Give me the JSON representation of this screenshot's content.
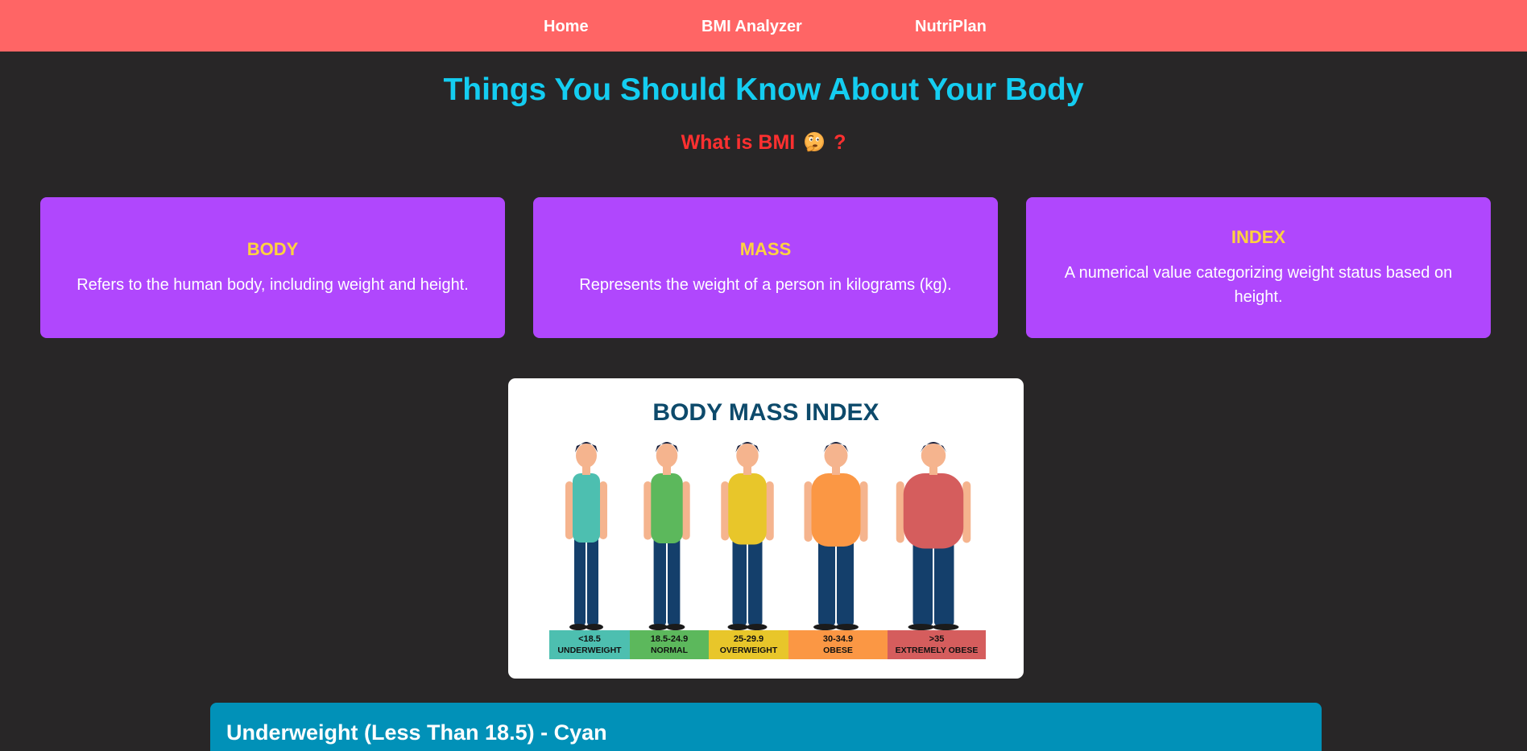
{
  "nav": {
    "home": "Home",
    "bmi_analyzer": "BMI Analyzer",
    "nutriplan": "NutriPlan"
  },
  "hero": {
    "title": "Things You Should Know About Your Body",
    "subtitle_prefix": "What is BMI",
    "subtitle_suffix": "?",
    "emoji": "thinking-face-icon"
  },
  "cards": [
    {
      "title": "BODY",
      "text": "Refers to the human body, including weight and height."
    },
    {
      "title": "MASS",
      "text": "Represents the weight of a person in kilograms (kg)."
    },
    {
      "title": "INDEX",
      "text": "A numerical value categorizing weight status based on height."
    }
  ],
  "bmi_chart": {
    "title": "BODY MASS INDEX",
    "categories": [
      {
        "range": "<18.5",
        "label": "UNDERWEIGHT",
        "color": "#4dbfb0"
      },
      {
        "range": "18.5-24.9",
        "label": "NORMAL",
        "color": "#5cb85c"
      },
      {
        "range": "25-29.9",
        "label": "OVERWEIGHT",
        "color": "#e8c62a"
      },
      {
        "range": "30-34.9",
        "label": "OBESE",
        "color": "#fb9744"
      },
      {
        "range": ">35",
        "label": "EXTREMELY OBESE",
        "color": "#d55d5d"
      }
    ]
  },
  "info": {
    "heading": "Underweight (Less Than 18.5) - Cyan"
  },
  "colors": {
    "nav_bg": "#ff6565",
    "page_bg": "#282627",
    "title": "#14cdf1",
    "subtitle": "#ff3030",
    "card_bg": "#b047fd",
    "card_title": "#ffd23f",
    "info_bg": "#0191b8"
  }
}
